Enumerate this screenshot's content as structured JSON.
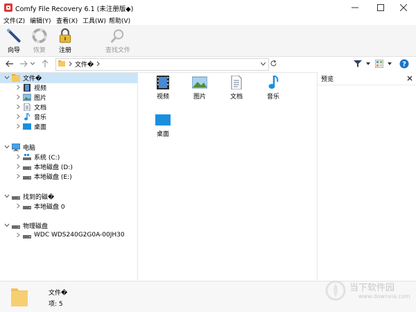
{
  "window": {
    "title": "Comfy File Recovery 6.1 (未注册版◆)"
  },
  "menu": [
    "文件(Z)",
    "编辑(Y)",
    "查看(X)",
    "工具(W)",
    "帮助(V)"
  ],
  "toolbar": {
    "wizard": "向导",
    "restore": "恢复",
    "register": "注册",
    "find": "查找文件"
  },
  "address": {
    "path": "文件�"
  },
  "preview": {
    "title": "预览"
  },
  "tree": {
    "files": {
      "label": "文件�",
      "children": [
        "视频",
        "图片",
        "文档",
        "音乐",
        "桌面"
      ]
    },
    "computer": {
      "label": "电脑",
      "children": [
        "系统 (C:)",
        "本地磁盘 (D:)",
        "本地磁盘 (E:)"
      ]
    },
    "found": {
      "label": "找到的磁�",
      "children": [
        "本地磁盘 0"
      ]
    },
    "physical": {
      "label": "物理磁盘",
      "children": [
        "WDC WDS240G2G0A-00JH30"
      ]
    }
  },
  "content": {
    "items": [
      "视频",
      "图片",
      "文档",
      "音乐",
      "桌面"
    ]
  },
  "status": {
    "name": "文件�",
    "count_label": "项: ",
    "count": "5"
  },
  "watermark": {
    "brand": "当下软件园",
    "url": "www.downxia.com"
  },
  "colors": {
    "accent": "#1a73c9",
    "selection": "#cce4f7",
    "folder": "#f6c85f"
  }
}
